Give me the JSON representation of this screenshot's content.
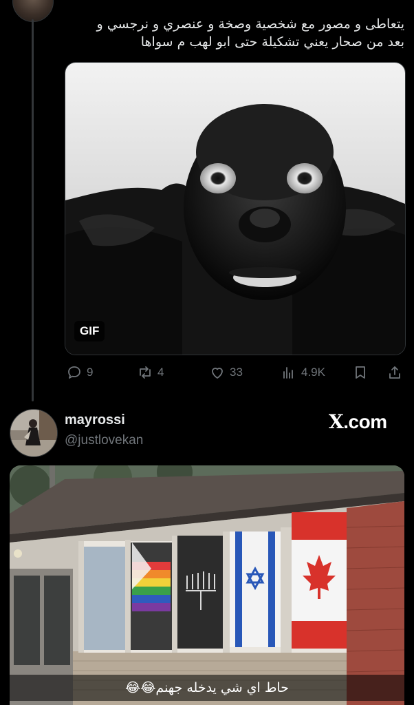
{
  "tweet": {
    "text_lines": [
      "يتعاطى و مصور مع شخصية وصخة و عنصري و نرجسي و",
      "بعد من صحار يعني تشكيلة حتى ابو لهب م سواها"
    ],
    "media_badge": "GIF"
  },
  "actions": {
    "replies": "9",
    "reposts": "4",
    "likes": "33",
    "views": "4.9K"
  },
  "post2": {
    "display_name": "mayrossi",
    "handle": "@justlovekan",
    "source_label": "X",
    "source_suffix": ".com",
    "caption": "حاط اي شي يدخله جهنم😂😂"
  },
  "colors": {
    "background": "#000000",
    "text": "#e7e9ea",
    "muted": "#71767b",
    "border": "#2f3336"
  }
}
